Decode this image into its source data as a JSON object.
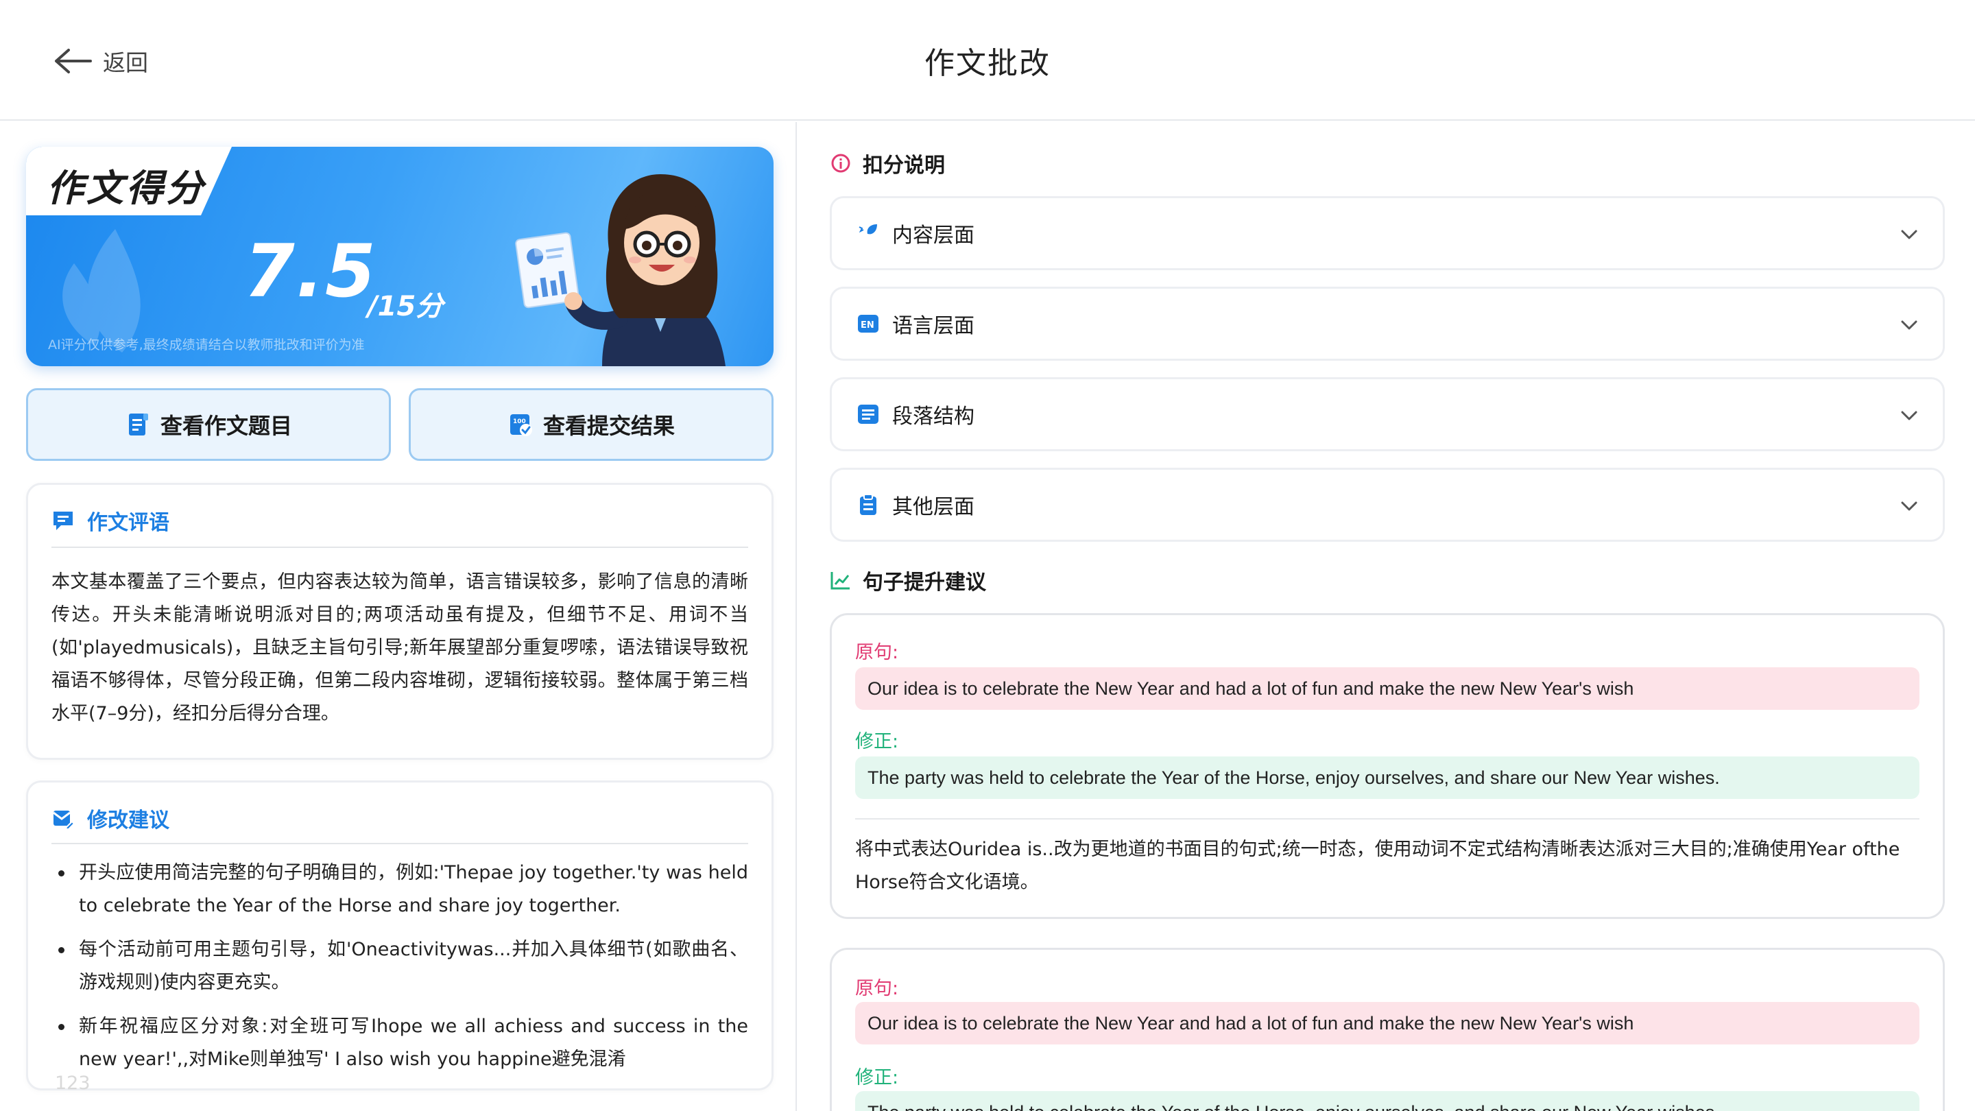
{
  "header": {
    "back_label": "返回",
    "title": "作文批改"
  },
  "score": {
    "tab_title": "作文得分",
    "value": "7.5",
    "total": "/15分",
    "note": "AI评分仅供参考,最终成绩请结合以教师批改和评价为准"
  },
  "buttons": {
    "view_topic": "查看作文题目",
    "view_result": "查看提交结果"
  },
  "comment": {
    "title": "作文评语",
    "text": "本文基本覆盖了三个要点，但内容表达较为简单，语言错误较多，影响了信息的清晰传达。开头未能清晰说明派对目的;两项活动虽有提及，但细节不足、用词不当(如'playedmusicals)，且缺乏主旨句引导;新年展望部分重复啰嗦，语法错误导致祝福语不够得体，尽管分段正确，但第二段内容堆砌，逻辑衔接较弱。整体属于第三档水平(7–9分)，经扣分后得分合理。"
  },
  "suggestions": {
    "title": "修改建议",
    "items": [
      "开头应使用简洁完整的句子明确目的，例如:'Thepae joy together.'ty was held to celebrate the Year of the Horse and share joy togerther.",
      "每个活动前可用主题句引导，如'Oneactivitywas...并加入具体细节(如歌曲名、游戏规则)使内容更充实。",
      "新年祝福应区分对象:对全班可写Ihope we all achiess and success in the new year!',,对Mike则单独写' I also wish you happine避免混淆"
    ],
    "faded_tail": "123"
  },
  "deduction": {
    "title": "扣分说明",
    "items": [
      {
        "label": "内容层面",
        "icon": "feather-icon"
      },
      {
        "label": "语言层面",
        "icon": "en-badge-icon"
      },
      {
        "label": "段落结构",
        "icon": "list-icon"
      },
      {
        "label": "其他层面",
        "icon": "clipboard-icon"
      }
    ]
  },
  "sentences": {
    "title": "句子提升建议",
    "orig_label": "原句:",
    "fix_label": "修正:",
    "cards": [
      {
        "original": "Our idea is to celebrate the New Year and had a lot of fun and make the new New Year's wish",
        "fixed": "The party was held to celebrate the Year of the Horse, enjoy ourselves, and share our New Year wishes.",
        "explanation": "将中式表达Ouridea is..改为更地道的书面目的句式;统一时态，使用动词不定式结构清晰表达派对三大目的;准确使用Year ofthe Horse符合文化语境。"
      },
      {
        "original": "Our idea is to celebrate the New Year and had a lot of fun and make the new New Year's wish",
        "fixed": "The party was held to celebrate the Year of the Horse, enjoy ourselves, and share our New Year wishes."
      }
    ]
  },
  "colors": {
    "accent": "#1d7fe2",
    "original": "#e13a72",
    "fixed": "#20b27a"
  }
}
